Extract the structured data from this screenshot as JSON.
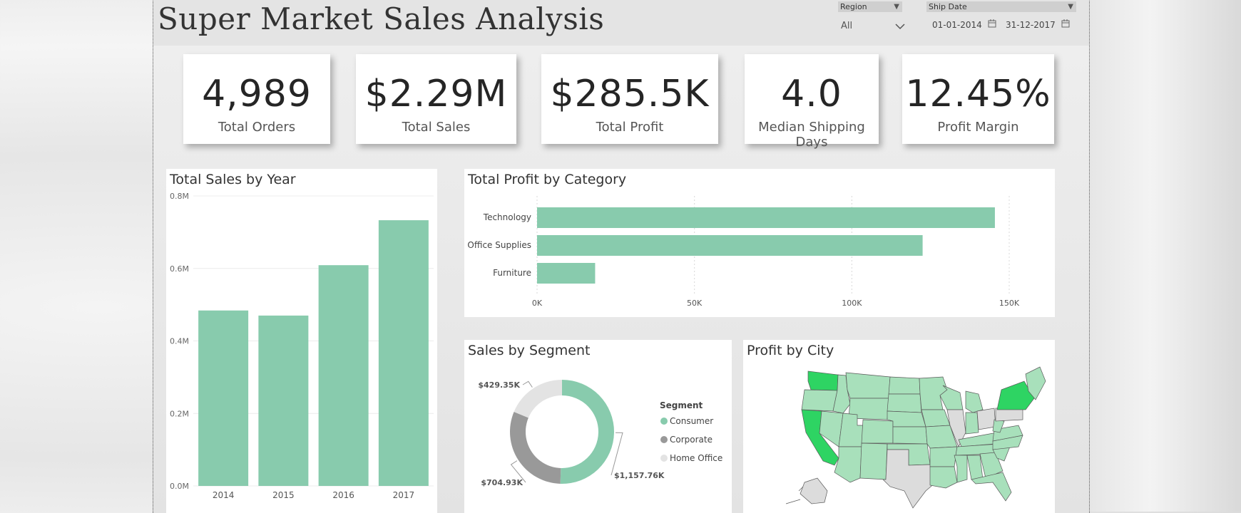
{
  "title": "Super Market Sales Analysis",
  "filters": {
    "region": {
      "label": "Region",
      "value": "All"
    },
    "ship_date": {
      "label": "Ship Date",
      "start": "01-01-2014",
      "end": "31-12-2017"
    }
  },
  "kpis": [
    {
      "value": "4,989",
      "label": "Total Orders"
    },
    {
      "value": "$2.29M",
      "label": "Total Sales"
    },
    {
      "value": "$285.5K",
      "label": "Total Profit"
    },
    {
      "value": "4.0",
      "label": "Median Shipping Days"
    },
    {
      "value": "12.45%",
      "label": "Profit Margin"
    }
  ],
  "colors": {
    "bar": "#88cbad",
    "consumer": "#88cbad",
    "corporate": "#999999",
    "home_office": "#e3e3e3",
    "map_base": "#a8e0bb",
    "map_high": "#2ed463",
    "map_negative": "#dcdcdc"
  },
  "map": {
    "title": "Profit by City"
  },
  "chart_data": [
    {
      "type": "bar",
      "title": "Total Sales by Year",
      "categories": [
        "2014",
        "2015",
        "2016",
        "2017"
      ],
      "values": [
        0.484,
        0.47,
        0.609,
        0.733
      ],
      "yticks": [
        "0.0M",
        "0.2M",
        "0.4M",
        "0.6M",
        "0.8M"
      ],
      "ylim": [
        0,
        0.8
      ]
    },
    {
      "type": "bar",
      "orientation": "horizontal",
      "title": "Total Profit by Category",
      "categories": [
        "Technology",
        "Office Supplies",
        "Furniture"
      ],
      "values": [
        145455,
        122491,
        18451
      ],
      "xticks": [
        "0K",
        "50K",
        "100K",
        "150K"
      ],
      "xlim": [
        0,
        150000
      ]
    },
    {
      "type": "pie",
      "variant": "donut",
      "title": "Sales by Segment",
      "legend_title": "Segment",
      "slices": [
        {
          "name": "Consumer",
          "value": 1157.76,
          "label": "$1,157.76K",
          "color": "#88cbad"
        },
        {
          "name": "Corporate",
          "value": 704.93,
          "label": "$704.93K",
          "color": "#999999"
        },
        {
          "name": "Home Office",
          "value": 429.35,
          "label": "$429.35K",
          "color": "#e3e3e3"
        }
      ]
    }
  ]
}
